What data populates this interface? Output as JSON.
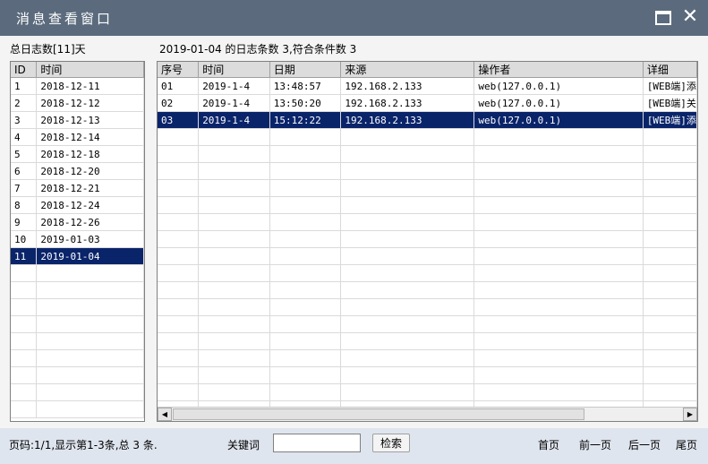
{
  "window": {
    "title": "消息查看窗口"
  },
  "left": {
    "summary": "总日志数[11]天",
    "columns": [
      "ID",
      "时间"
    ],
    "rows": [
      [
        "1",
        "2018-12-11"
      ],
      [
        "2",
        "2018-12-12"
      ],
      [
        "3",
        "2018-12-13"
      ],
      [
        "4",
        "2018-12-14"
      ],
      [
        "5",
        "2018-12-18"
      ],
      [
        "6",
        "2018-12-20"
      ],
      [
        "7",
        "2018-12-21"
      ],
      [
        "8",
        "2018-12-24"
      ],
      [
        "9",
        "2018-12-26"
      ],
      [
        "10",
        "2019-01-03"
      ],
      [
        "11",
        "2019-01-04"
      ]
    ],
    "selected_index": 10
  },
  "right": {
    "summary": "2019-01-04 的日志条数 3,符合条件数 3",
    "columns": [
      "序号",
      "时间",
      "日期",
      "来源",
      "操作者",
      "详细"
    ],
    "rows": [
      [
        "01",
        "2019-1-4",
        "13:48:57",
        "192.168.2.133",
        "web(127.0.0.1)",
        "[WEB端]添"
      ],
      [
        "02",
        "2019-1-4",
        "13:50:20",
        "192.168.2.133",
        "web(127.0.0.1)",
        "[WEB端]关"
      ],
      [
        "03",
        "2019-1-4",
        "15:12:22",
        "192.168.2.133",
        "web(127.0.0.1)",
        "[WEB端]添"
      ]
    ],
    "selected_index": 2
  },
  "footer": {
    "page_info": "页码:1/1,显示第1-3条,总 3 条.",
    "keyword_label": "关键词",
    "keyword_value": "",
    "search_button": "检索",
    "first": "首页",
    "prev": "前一页",
    "next": "后一页",
    "last": "尾页"
  }
}
